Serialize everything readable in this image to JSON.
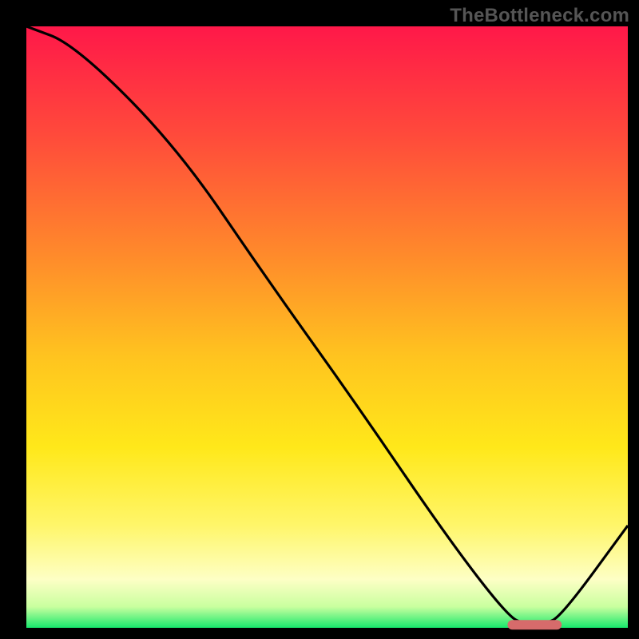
{
  "watermark": "TheBottleneck.com",
  "chart_data": {
    "type": "line",
    "title": "",
    "xlabel": "",
    "ylabel": "",
    "xlim": [
      0,
      100
    ],
    "ylim": [
      0,
      100
    ],
    "series": [
      {
        "name": "curve",
        "x": [
          0,
          8,
          25,
          40,
          55,
          70,
          80,
          83,
          86,
          89,
          100
        ],
        "values": [
          100,
          97,
          80,
          58,
          37,
          15,
          2,
          0.5,
          0.5,
          2,
          17
        ]
      }
    ],
    "marker": {
      "name": "optimal-range",
      "x_start": 80,
      "x_end": 89,
      "y": 0.5,
      "color": "#d66b6b"
    },
    "background_gradient": {
      "stops": [
        {
          "offset": 0.0,
          "color": "#ff1849"
        },
        {
          "offset": 0.18,
          "color": "#ff4a3b"
        },
        {
          "offset": 0.38,
          "color": "#ff8a2b"
        },
        {
          "offset": 0.55,
          "color": "#ffc41f"
        },
        {
          "offset": 0.7,
          "color": "#ffe81a"
        },
        {
          "offset": 0.83,
          "color": "#fff66a"
        },
        {
          "offset": 0.92,
          "color": "#fdffc5"
        },
        {
          "offset": 0.965,
          "color": "#c9ff9f"
        },
        {
          "offset": 1.0,
          "color": "#17e86c"
        }
      ]
    }
  }
}
